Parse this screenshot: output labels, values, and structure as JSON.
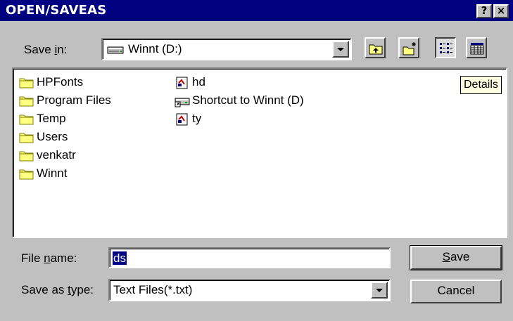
{
  "window": {
    "title": "OPEN/SAVEAS",
    "help_label": "?",
    "close_label": "×"
  },
  "save_in": {
    "label_pre": "Save ",
    "label_accel": "i",
    "label_post": "n:",
    "value": "Winnt (D:)",
    "drive_icon": "drive-icon"
  },
  "toolbar": {
    "buttons": [
      {
        "name": "up-one-level",
        "icon": "up-folder-icon"
      },
      {
        "name": "create-new-folder",
        "icon": "new-folder-icon"
      },
      {
        "name": "list-view",
        "icon": "list-view-icon",
        "pressed": true
      },
      {
        "name": "details-view",
        "icon": "details-view-icon"
      }
    ]
  },
  "tooltip": {
    "text": "Details"
  },
  "files": {
    "folders": [
      {
        "name": "HPFonts",
        "icon": "folder-icon"
      },
      {
        "name": "Program Files",
        "icon": "folder-icon"
      },
      {
        "name": "Temp",
        "icon": "folder-icon"
      },
      {
        "name": "Users",
        "icon": "folder-icon"
      },
      {
        "name": "venkatr",
        "icon": "folder-icon"
      },
      {
        "name": "Winnt",
        "icon": "folder-icon"
      }
    ],
    "others": [
      {
        "name": "hd",
        "icon": "text-file-icon"
      },
      {
        "name": "Shortcut to Winnt (D)",
        "icon": "drive-shortcut-icon"
      },
      {
        "name": "ty",
        "icon": "text-file-icon"
      }
    ]
  },
  "file_name": {
    "label_pre": "File ",
    "label_accel": "n",
    "label_post": "ame:",
    "value": "ds"
  },
  "save_as_type": {
    "label_pre": "Save as ",
    "label_accel": "t",
    "label_post": "ype:",
    "value": "Text Files(*.txt)"
  },
  "buttons": {
    "save_accel": "S",
    "save_rest": "ave",
    "cancel": "Cancel"
  },
  "colors": {
    "titlebar": "#000080",
    "face": "#c0c0c0",
    "folder": "#ffff80",
    "selection": "#000080",
    "tooltip": "#ffffe1"
  }
}
